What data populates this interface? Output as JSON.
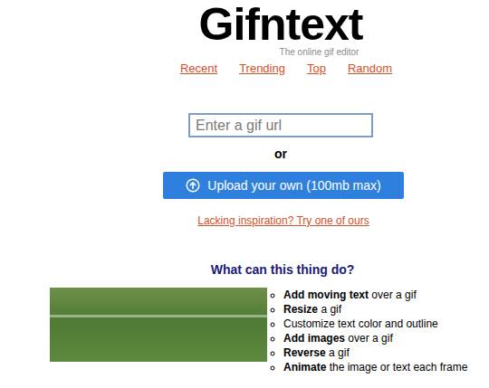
{
  "logo": {
    "title": "Gifntext",
    "tagline": "The online gif editor"
  },
  "nav": [
    "Recent",
    "Trending",
    "Top",
    "Random"
  ],
  "input": {
    "placeholder": "Enter a gif url"
  },
  "separator": "or",
  "upload": {
    "label": "Upload your own (100mb max)"
  },
  "inspiration_link": "Lacking inspiration? Try one of ours",
  "features": {
    "heading": "What can this thing do?",
    "items": [
      {
        "lead": "Add moving text",
        "rest": "over a gif",
        "bold": true
      },
      {
        "lead": "Resize",
        "rest": "a gif",
        "bold": true
      },
      {
        "lead": "Customize",
        "rest": "text color and outline",
        "bold": false
      },
      {
        "lead": "Add images",
        "rest": "over a gif",
        "bold": true
      },
      {
        "lead": "Reverse",
        "rest": "a gif",
        "bold": true
      },
      {
        "lead": "Animate",
        "rest": "the image or text each frame",
        "bold": true
      }
    ]
  }
}
